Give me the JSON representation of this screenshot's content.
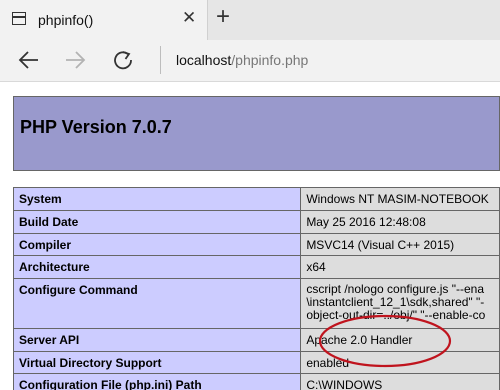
{
  "tab": {
    "title": "phpinfo()",
    "close_glyph": "✕",
    "new_tab_glyph": "+"
  },
  "address": {
    "host": "localhost",
    "path": "/phpinfo.php"
  },
  "page": {
    "title": "PHP Version 7.0.7",
    "rows": [
      {
        "label": "System",
        "value": "Windows NT MASIM-NOTEBOOK"
      },
      {
        "label": "Build Date",
        "value": "May 25 2016 12:48:08"
      },
      {
        "label": "Compiler",
        "value": "MSVC14 (Visual C++ 2015)"
      },
      {
        "label": "Architecture",
        "value": "x64"
      },
      {
        "label": "Configure Command",
        "value_lines": [
          "cscript /nologo configure.js \"--ena",
          "\\instantclient_12_1\\sdk,shared\" \"-",
          "object-out-dir=../obj/\" \"--enable-co"
        ]
      },
      {
        "label": "Server API",
        "value": "Apache 2.0 Handler"
      },
      {
        "label": "Virtual Directory Support",
        "value": "enabled"
      },
      {
        "label": "Configuration File (php.ini) Path",
        "value": "C:\\WINDOWS"
      }
    ]
  },
  "icons": {
    "tab": "page-icon",
    "back": "arrow-left-icon",
    "forward": "arrow-right-icon",
    "reload": "refresh-icon"
  },
  "colors": {
    "header_bg": "#9999cc",
    "label_bg": "#ccccff",
    "value_bg": "#dddddd",
    "annotation": "#c0141e"
  }
}
